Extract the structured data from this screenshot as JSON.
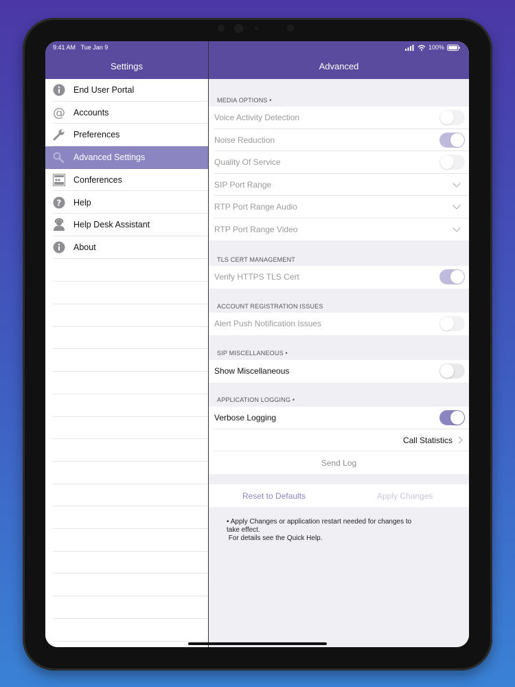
{
  "status_bar": {
    "time": "9:41 AM",
    "date": "Tue Jan 9",
    "battery": "100%"
  },
  "left_nav": {
    "title": "Settings"
  },
  "right_nav": {
    "title": "Advanced"
  },
  "sidebar": {
    "items": [
      {
        "label": "End User Portal",
        "icon": "info-icon"
      },
      {
        "label": "Accounts",
        "icon": "at-icon"
      },
      {
        "label": "Preferences",
        "icon": "wrench-icon"
      },
      {
        "label": "Advanced Settings",
        "icon": "advanced-icon",
        "selected": true
      },
      {
        "label": "Conferences",
        "icon": "conference-icon"
      },
      {
        "label": "Help",
        "icon": "help-icon"
      },
      {
        "label": "Help Desk Assistant",
        "icon": "help-desk-icon"
      },
      {
        "label": "About",
        "icon": "about-icon"
      }
    ]
  },
  "media_options": {
    "header": "MEDIA OPTIONS •",
    "voice_activity": {
      "label": "Voice Activity Detection",
      "on": false
    },
    "noise_reduction": {
      "label": "Noise Reduction",
      "on": true
    },
    "qos": {
      "label": "Quality Of Service",
      "on": false
    },
    "sip_port": {
      "label": "SIP Port Range"
    },
    "rtp_audio": {
      "label": "RTP Port Range Audio"
    },
    "rtp_video": {
      "label": "RTP Port Range Video"
    }
  },
  "tls": {
    "header": "TLS CERT MANAGEMENT",
    "verify": {
      "label": "Verify HTTPS TLS Cert",
      "on": true
    }
  },
  "account_registration": {
    "header": "ACCOUNT REGISTRATION ISSUES",
    "alert": {
      "label": "Alert Push Notification Issues",
      "on": false
    }
  },
  "sip_misc": {
    "header": "SIP MISCELLANEOUS •",
    "show": {
      "label": "Show Miscellaneous",
      "on": false
    }
  },
  "app_logging": {
    "header": "APPLICATION LOGGING •",
    "verbose": {
      "label": "Verbose Logging",
      "on": true
    },
    "call_stats": "Call Statistics",
    "send_log": "Send Log"
  },
  "actions": {
    "reset": "Reset to Defaults",
    "apply": "Apply Changes"
  },
  "footnote": {
    "line1": "• Apply Changes or application restart needed for changes to",
    "line2": "take effect.",
    "line3": " For details see the Quick Help."
  },
  "colors": {
    "nav": "#5a4b9e",
    "accent": "#8b85c1"
  }
}
